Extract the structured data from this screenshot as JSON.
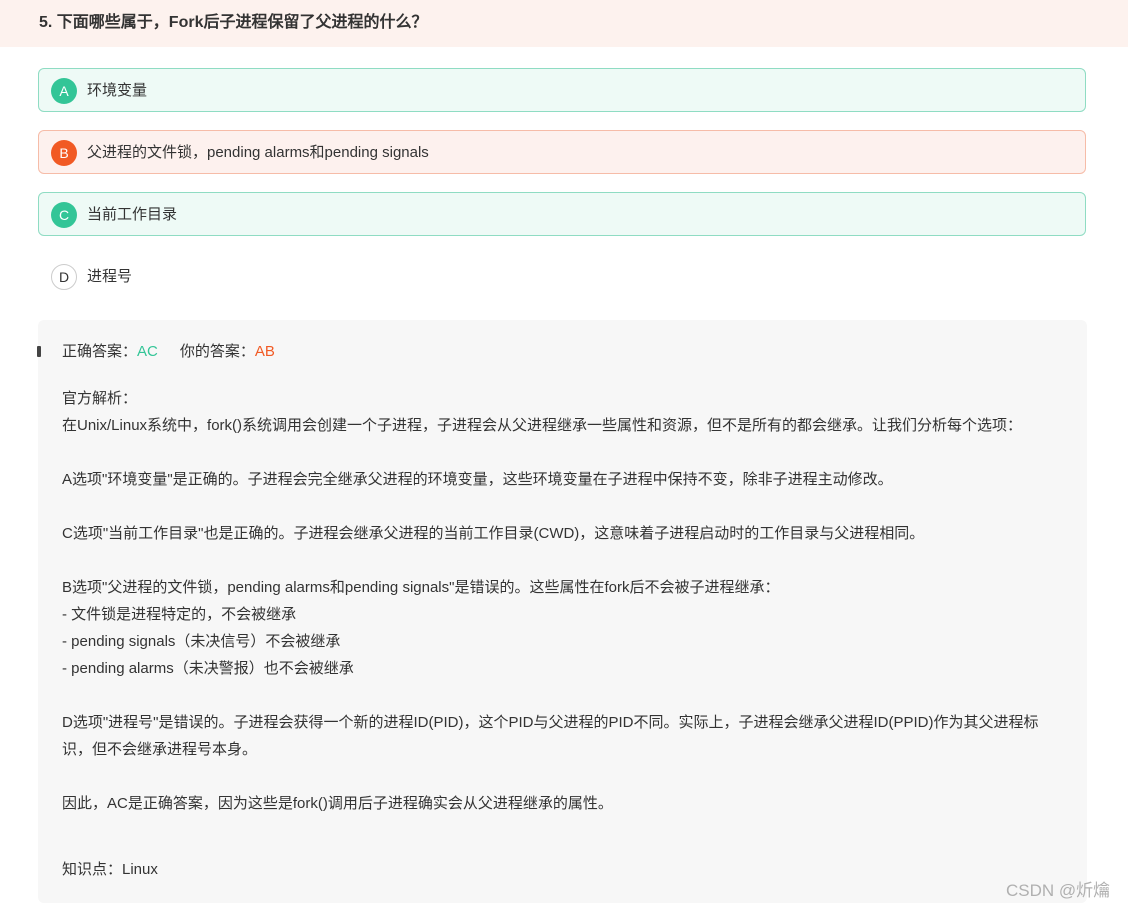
{
  "question": {
    "title": "5. 下面哪些属于，Fork后子进程保留了父进程的什么？"
  },
  "options": [
    {
      "letter": "A",
      "text": "环境变量",
      "state": "correct"
    },
    {
      "letter": "B",
      "text": "父进程的文件锁，pending alarms和pending signals",
      "state": "wrong-selected"
    },
    {
      "letter": "C",
      "text": "当前工作目录",
      "state": "correct"
    },
    {
      "letter": "D",
      "text": "进程号",
      "state": "unselected"
    }
  ],
  "result": {
    "correct_label": "正确答案：",
    "correct_value": "AC",
    "user_label": "你的答案：",
    "user_value": "AB"
  },
  "explanation": {
    "heading": "官方解析：",
    "intro": "在Unix/Linux系统中，fork()系统调用会创建一个子进程，子进程会从父进程继承一些属性和资源，但不是所有的都会继承。让我们分析每个选项：",
    "a": "A选项\"环境变量\"是正确的。子进程会完全继承父进程的环境变量，这些环境变量在子进程中保持不变，除非子进程主动修改。",
    "c": "C选项\"当前工作目录\"也是正确的。子进程会继承父进程的当前工作目录(CWD)，这意味着子进程启动时的工作目录与父进程相同。",
    "b": "B选项\"父进程的文件锁，pending alarms和pending signals\"是错误的。这些属性在fork后不会被子进程继承：",
    "b_items": [
      "- 文件锁是进程特定的，不会被继承",
      "- pending signals（未决信号）不会被继承",
      "- pending alarms（未决警报）也不会被继承"
    ],
    "d": "D选项\"进程号\"是错误的。子进程会获得一个新的进程ID(PID)，这个PID与父进程的PID不同。实际上，子进程会继承父进程ID(PPID)作为其父进程标识，但不会继承进程号本身。",
    "conclusion": "因此，AC是正确答案，因为这些是fork()调用后子进程确实会从父进程继承的属性。"
  },
  "knowledge": {
    "text": "知识点：Linux"
  },
  "watermark": "CSDN @炘爚",
  "colors": {
    "correct": "#33c597",
    "wrong": "#f15a24",
    "header_bg": "#fdf2ee",
    "analysis_bg": "#f7f7f7"
  }
}
